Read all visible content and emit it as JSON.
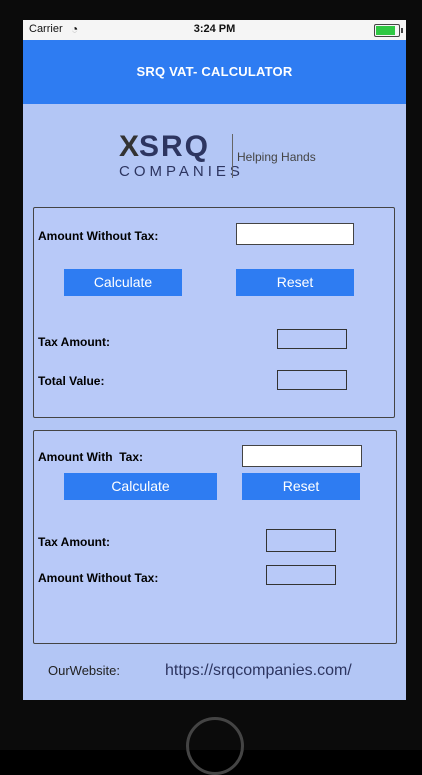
{
  "status_bar": {
    "carrier": "Carrier",
    "time": "3:24 PM"
  },
  "nav": {
    "title": "SRQ VAT- CALCULATOR"
  },
  "logo": {
    "mark": "X",
    "name": "SRQ",
    "subtitle": "COMPANIES",
    "tagline": "Helping Hands"
  },
  "section1": {
    "input_label": "Amount Without Tax:",
    "input_value": "",
    "calculate_label": "Calculate",
    "reset_label": "Reset",
    "tax_label": "Tax Amount:",
    "tax_value": "",
    "total_label": "Total Value:",
    "total_value": ""
  },
  "section2": {
    "input_label": "Amount With  Tax:",
    "input_value": "",
    "calculate_label": "Calculate",
    "reset_label": "Reset",
    "tax_label": "Tax Amount:",
    "tax_value": "",
    "without_label": "Amount Without Tax:",
    "without_value": ""
  },
  "footer": {
    "label": "OurWebsite:",
    "url": "https://srqcompanies.com/"
  },
  "colors": {
    "accent": "#2e7cf2",
    "background": "#b3c6f5"
  }
}
